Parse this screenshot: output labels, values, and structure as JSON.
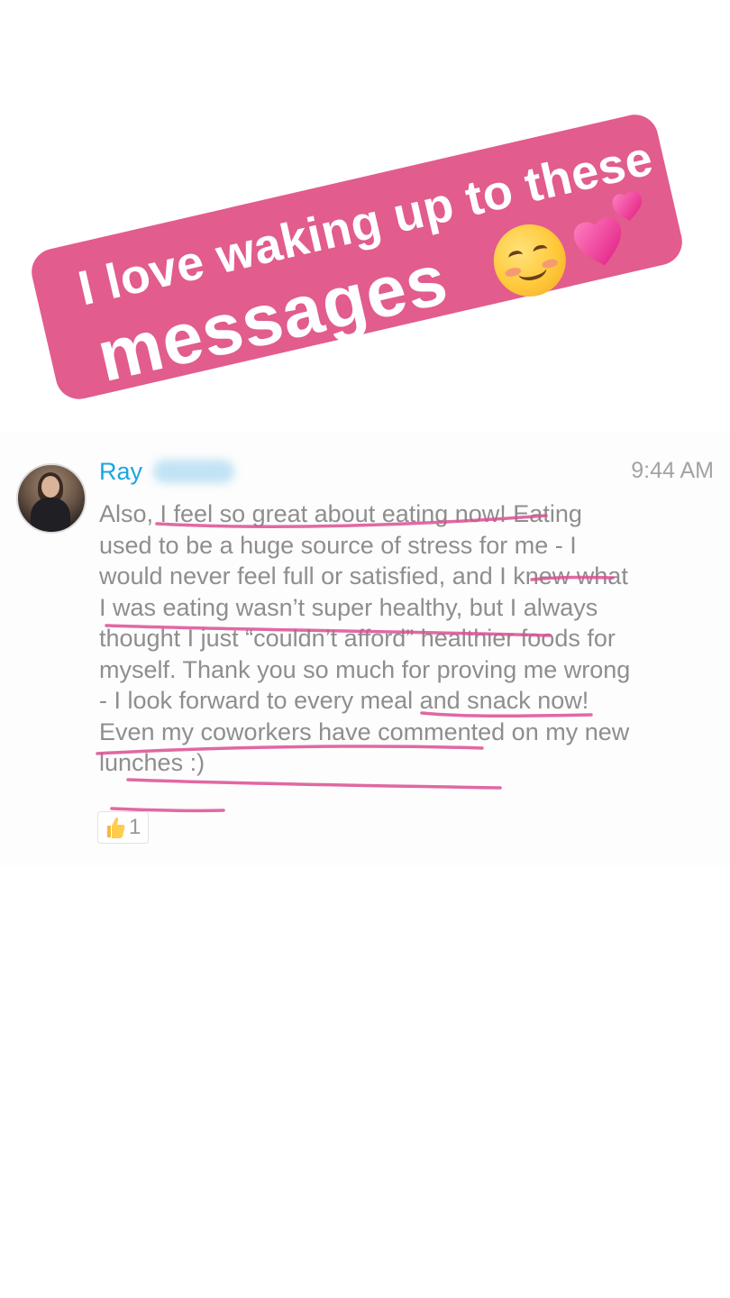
{
  "story_caption": {
    "line1": "I love waking up to these",
    "line2": "messages",
    "emoji": [
      "smiling-face-emoji",
      "two-hearts-emoji"
    ],
    "background_color": "#e25c8e"
  },
  "message": {
    "sender_first_name": "Ray",
    "timestamp": "9:44 AM",
    "body": "Also, I feel so great about eating now! Eating used to be a huge source of stress for me - I would never feel full or satisfied, and I knew what I was eating wasn’t super healthy, but I always thought I just “couldn’t afford” healthier foods for myself. Thank you so much for proving me wrong - I look forward to every meal and snack now! Even my coworkers have commented on my new lunches :)",
    "reaction": {
      "icon": "thumbs-up-icon",
      "count": "1"
    },
    "name_color": "#1aa6e0",
    "highlight_color": "#dc4f93"
  }
}
